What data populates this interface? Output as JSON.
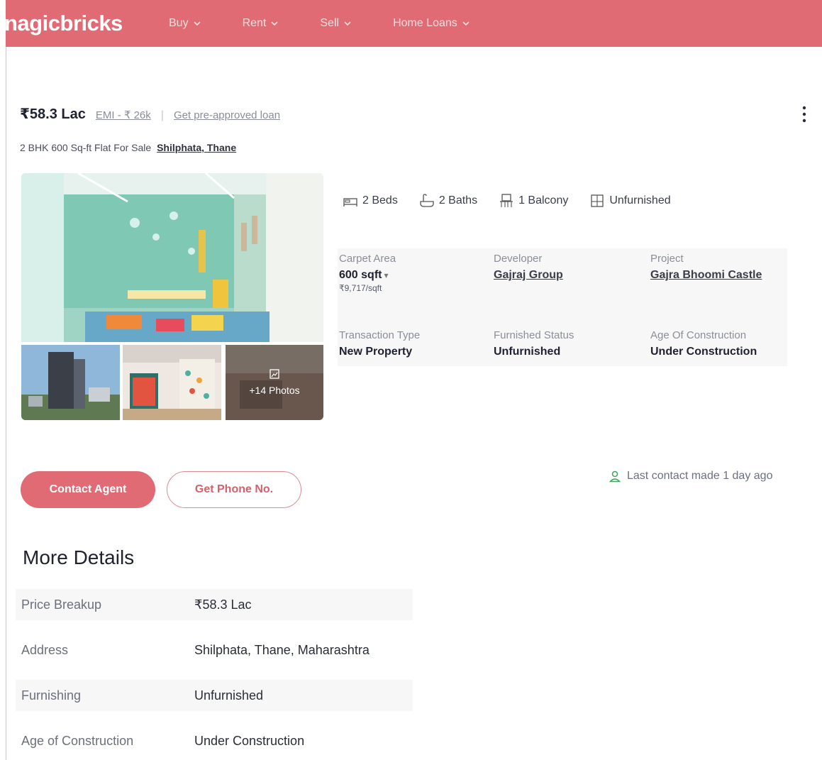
{
  "header": {
    "logo": "nagicbricks",
    "nav": [
      {
        "label": "Buy"
      },
      {
        "label": "Rent"
      },
      {
        "label": "Sell"
      },
      {
        "label": "Home Loans"
      }
    ]
  },
  "listing": {
    "price": "₹58.3 Lac",
    "emi": "EMI - ₹ 26k",
    "separator": "|",
    "loan_link": "Get pre-approved loan",
    "subtitle": "2 BHK 600 Sq-ft Flat For Sale",
    "location": "Shilphata, Thane",
    "more_photos": "+14 Photos"
  },
  "amenities": [
    {
      "icon": "bed-icon",
      "label": "2 Beds"
    },
    {
      "icon": "bath-icon",
      "label": "2 Baths"
    },
    {
      "icon": "balcony-icon",
      "label": "1 Balcony"
    },
    {
      "icon": "furnishing-icon",
      "label": "Unfurnished"
    }
  ],
  "summary": {
    "carpet_area": {
      "label": "Carpet Area",
      "value": "600 sqft",
      "caret": "▾",
      "sub": "₹9,717/sqft"
    },
    "developer": {
      "label": "Developer",
      "value": "Gajraj Group"
    },
    "project": {
      "label": "Project",
      "value": "Gajra Bhoomi Castle"
    },
    "transaction": {
      "label": "Transaction Type",
      "value": "New Property"
    },
    "furnished": {
      "label": "Furnished Status",
      "value": "Unfurnished"
    },
    "age": {
      "label": "Age Of Construction",
      "value": "Under Construction"
    }
  },
  "actions": {
    "contact_agent": "Contact Agent",
    "get_phone": "Get Phone No.",
    "last_contact": "Last contact made 1 day ago"
  },
  "more_details": {
    "title": "More Details",
    "rows": [
      {
        "label": "Price Breakup",
        "value": "₹58.3 Lac"
      },
      {
        "label": "Address",
        "value": "Shilphata, Thane, Maharashtra"
      },
      {
        "label": "Furnishing",
        "value": "Unfurnished"
      },
      {
        "label": "Age of Construction",
        "value": "Under Construction"
      }
    ]
  },
  "colors": {
    "brand": "#e06b74",
    "text": "#30323d",
    "muted": "#8b8e99",
    "success_icon": "#3aa65a"
  }
}
